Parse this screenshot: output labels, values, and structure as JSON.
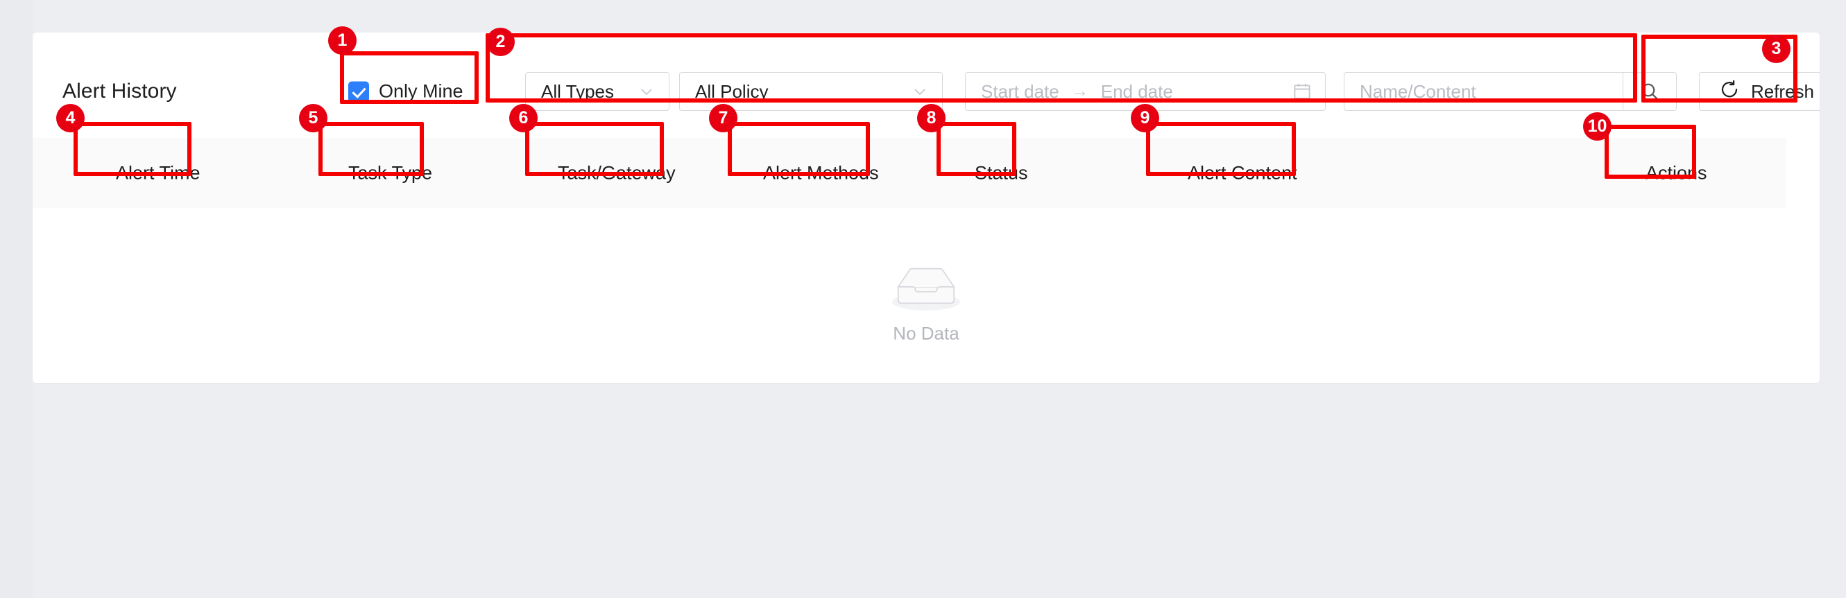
{
  "page": {
    "background_color": "#eceef2",
    "card_background": "#ffffff"
  },
  "header": {
    "title": "Alert History"
  },
  "filters": {
    "only_mine": {
      "label": "Only Mine",
      "checked": true,
      "accent_color": "#2d7ff9"
    },
    "type_select": {
      "value": "All Types",
      "icon": "chevron-down-icon"
    },
    "policy_select": {
      "value": "All Policy",
      "icon": "chevron-down-icon"
    },
    "date_range": {
      "start_placeholder": "Start date",
      "separator": "→",
      "end_placeholder": "End date",
      "icon": "calendar-icon"
    },
    "search": {
      "placeholder": "Name/Content",
      "value": "",
      "icon": "search-icon"
    },
    "refresh_button": {
      "label": "Refresh",
      "icon": "refresh-icon"
    }
  },
  "table": {
    "columns": [
      {
        "label": "Alert Time"
      },
      {
        "label": "Task Type"
      },
      {
        "label": "Task/Gateway"
      },
      {
        "label": "Alert Methods"
      },
      {
        "label": "Status"
      },
      {
        "label": "Alert Content"
      },
      {
        "label": "Actions"
      }
    ],
    "rows": [],
    "empty_state": {
      "text": "No Data",
      "icon": "empty-box-icon"
    }
  },
  "annotations": {
    "color": "#e60012",
    "markers": [
      {
        "number": "1",
        "target": "only-mine-checkbox"
      },
      {
        "number": "2",
        "target": "filters-group"
      },
      {
        "number": "3",
        "target": "refresh-button"
      },
      {
        "number": "4",
        "target": "column-alert-time"
      },
      {
        "number": "5",
        "target": "column-task-type"
      },
      {
        "number": "6",
        "target": "column-task-gateway"
      },
      {
        "number": "7",
        "target": "column-alert-methods"
      },
      {
        "number": "8",
        "target": "column-status"
      },
      {
        "number": "9",
        "target": "column-alert-content"
      },
      {
        "number": "10",
        "target": "column-actions"
      }
    ]
  }
}
